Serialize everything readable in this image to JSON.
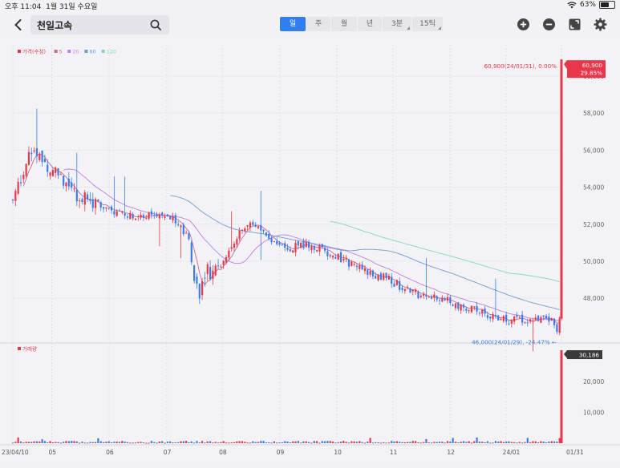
{
  "status_bar": {
    "time": "오후 11:04",
    "date": "1월 31일 수요일",
    "battery": "63%",
    "battery_fraction": 0.63
  },
  "header": {
    "stock_name": "천일고속",
    "icons": [
      "back-icon",
      "search-icon",
      "zoom-in-icon",
      "zoom-out-icon",
      "fullscreen-icon",
      "gear-icon"
    ]
  },
  "period_tabs": [
    {
      "label": "일",
      "active": true,
      "dropdown": false
    },
    {
      "label": "주",
      "active": false,
      "dropdown": false
    },
    {
      "label": "월",
      "active": false,
      "dropdown": false
    },
    {
      "label": "년",
      "active": false,
      "dropdown": false
    },
    {
      "label": "3분",
      "active": false,
      "dropdown": true
    },
    {
      "label": "15틱",
      "active": false,
      "dropdown": true
    }
  ],
  "colors": {
    "up": "#e8364a",
    "down": "#3d7be8",
    "ma5": "#c9669b",
    "ma20": "#c07cf0",
    "ma60": "#6f9cd6",
    "ma120": "#7fd2cc",
    "accent": "#2f7ff0",
    "last_price_bg": "#e8364a",
    "volume_last_bg": "#3a3a3a"
  },
  "price_legend": [
    {
      "label": "가격(수정)",
      "color": "#e8364a"
    },
    {
      "label": "5",
      "color": "#c9669b"
    },
    {
      "label": "20",
      "color": "#c07cf0"
    },
    {
      "label": "60",
      "color": "#6f9cd6"
    },
    {
      "label": "120",
      "color": "#7fd2cc"
    }
  ],
  "volume_legend": [
    {
      "label": "거래량",
      "color": "#e8364a"
    }
  ],
  "chart_data": {
    "type": "candlestick",
    "price_axis": {
      "min": 45800,
      "max": 61600,
      "ticks": [
        48000,
        50000,
        52000,
        54000,
        56000,
        58000,
        60000
      ],
      "tick_labels": [
        "48,000",
        "50,000",
        "52,000",
        "54,000",
        "56,000",
        "58,000",
        "60,000"
      ]
    },
    "volume_axis": {
      "min": 0,
      "max": 31500,
      "ticks": [
        10000,
        20000
      ],
      "tick_labels": [
        "10,000",
        "20,000"
      ]
    },
    "x_labels": [
      "23/04/10",
      "05",
      "06",
      "07",
      "08",
      "09",
      "10",
      "11",
      "12",
      "24/01",
      "01/31"
    ],
    "x_label_days": [
      0,
      21,
      52,
      83,
      113,
      144,
      175,
      205,
      236,
      266,
      296
    ],
    "max_annotation": {
      "text": "60,900(24/01/31), 0.00%",
      "value": 60900
    },
    "min_annotation": {
      "text": "46,000(24/01/29), -24.47%",
      "value": 46000
    },
    "last_price": {
      "price": "60,900",
      "change": "29.85%",
      "value": 60900
    },
    "last_volume": {
      "label": "30,186",
      "value": 30186
    },
    "trend_keypoints": [
      [
        0,
        53300
      ],
      [
        10,
        56200
      ],
      [
        21,
        55000
      ],
      [
        35,
        53600
      ],
      [
        52,
        52800
      ],
      [
        66,
        52500
      ],
      [
        83,
        52600
      ],
      [
        95,
        51200
      ],
      [
        100,
        48000
      ],
      [
        104,
        49300
      ],
      [
        113,
        49800
      ],
      [
        120,
        51300
      ],
      [
        130,
        52100
      ],
      [
        140,
        51000
      ],
      [
        144,
        50700
      ],
      [
        160,
        50900
      ],
      [
        175,
        50200
      ],
      [
        190,
        49500
      ],
      [
        205,
        48900
      ],
      [
        215,
        48300
      ],
      [
        236,
        47800
      ],
      [
        250,
        47300
      ],
      [
        266,
        46800
      ],
      [
        285,
        46900
      ],
      [
        293,
        46600
      ],
      [
        294,
        46100
      ],
      [
        295,
        47000
      ]
    ],
    "last_bar": {
      "day": 296,
      "open": 46900,
      "high": 60900,
      "low": 46800,
      "close": 60900
    }
  }
}
